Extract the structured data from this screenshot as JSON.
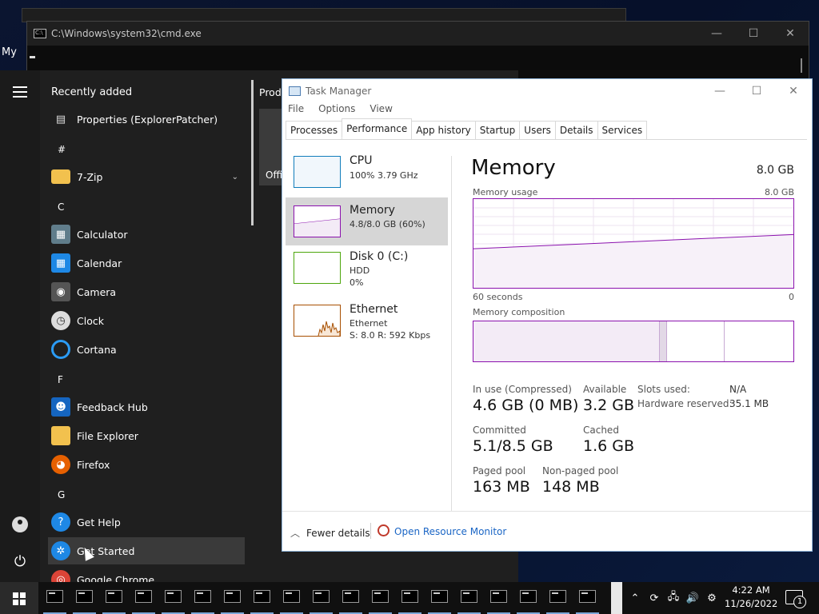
{
  "desktop": {
    "label": "My"
  },
  "cmd": {
    "title": "C:\\Windows\\system32\\cmd.exe",
    "min": "—",
    "max": "☐",
    "close": "✕"
  },
  "start": {
    "section": "Recently added",
    "tiles_head": "Produ",
    "tile_label": "Offi",
    "letters": [
      "#",
      "C",
      "F",
      "G"
    ],
    "apps": [
      {
        "label": "Properties (ExplorerPatcher)",
        "icon": "settings-icon"
      },
      {
        "label": "7-Zip",
        "icon": "folder-icon"
      },
      {
        "label": "Calculator",
        "icon": "calculator-icon"
      },
      {
        "label": "Calendar",
        "icon": "calendar-icon"
      },
      {
        "label": "Camera",
        "icon": "camera-icon"
      },
      {
        "label": "Clock",
        "icon": "clock-icon"
      },
      {
        "label": "Cortana",
        "icon": "cortana-icon"
      },
      {
        "label": "Feedback Hub",
        "icon": "feedback-icon"
      },
      {
        "label": "File Explorer",
        "icon": "folder-icon"
      },
      {
        "label": "Firefox",
        "icon": "firefox-icon"
      },
      {
        "label": "Get Help",
        "icon": "help-icon"
      },
      {
        "label": "Get Started",
        "icon": "get-started-icon"
      },
      {
        "label": "Google Chrome",
        "icon": "chrome-icon"
      }
    ],
    "chevron": "⌄"
  },
  "taskmgr": {
    "title": "Task Manager",
    "min": "—",
    "max": "☐",
    "close": "✕",
    "menu": [
      "File",
      "Options",
      "View"
    ],
    "tabs": [
      "Processes",
      "Performance",
      "App history",
      "Startup",
      "Users",
      "Details",
      "Services"
    ],
    "active_tab": "Performance",
    "side": [
      {
        "name": "CPU",
        "l1": "100%  3.79 GHz",
        "l2": "",
        "color": "#117dbb"
      },
      {
        "name": "Memory",
        "l1": "4.8/8.0 GB (60%)",
        "l2": "",
        "color": "#8b12ae"
      },
      {
        "name": "Disk 0 (C:)",
        "l1": "HDD",
        "l2": "0%",
        "color": "#4da60c"
      },
      {
        "name": "Ethernet",
        "l1": "Ethernet",
        "l2": "S: 8.0  R: 592 Kbps",
        "color": "#a74f01"
      }
    ],
    "main": {
      "title": "Memory",
      "total": "8.0 GB",
      "usage_label": "Memory usage",
      "usage_max": "8.0 GB",
      "axis_left": "60 seconds",
      "axis_right": "0",
      "composition_label": "Memory composition",
      "in_use_label": "In use (Compressed)",
      "in_use_value": "4.6 GB (0 MB)",
      "available_label": "Available",
      "available_value": "3.2 GB",
      "committed_label": "Committed",
      "committed_value": "5.1/8.5 GB",
      "cached_label": "Cached",
      "cached_value": "1.6 GB",
      "paged_label": "Paged pool",
      "paged_value": "163 MB",
      "nonpaged_label": "Non-paged pool",
      "nonpaged_value": "148 MB",
      "slots_label": "Slots used:",
      "slots_value": "N/A",
      "hw_label": "Hardware reserved:",
      "hw_value": "35.1 MB",
      "usage_start": 0.44,
      "usage_end": 0.6
    },
    "fewer_details": "Fewer details",
    "resource_monitor": "Open Resource Monitor"
  },
  "taskbar": {
    "app_count": 19,
    "time": "4:22 AM",
    "date": "11/26/2022",
    "notif_count": "1",
    "tray_icons": [
      "chevron-up-icon",
      "sync-icon",
      "network-icon",
      "volume-icon",
      "settings-icon"
    ]
  },
  "colors": {
    "memory": "#8b12ae",
    "link": "#1a65c5",
    "selection": "#d6d6d6"
  }
}
